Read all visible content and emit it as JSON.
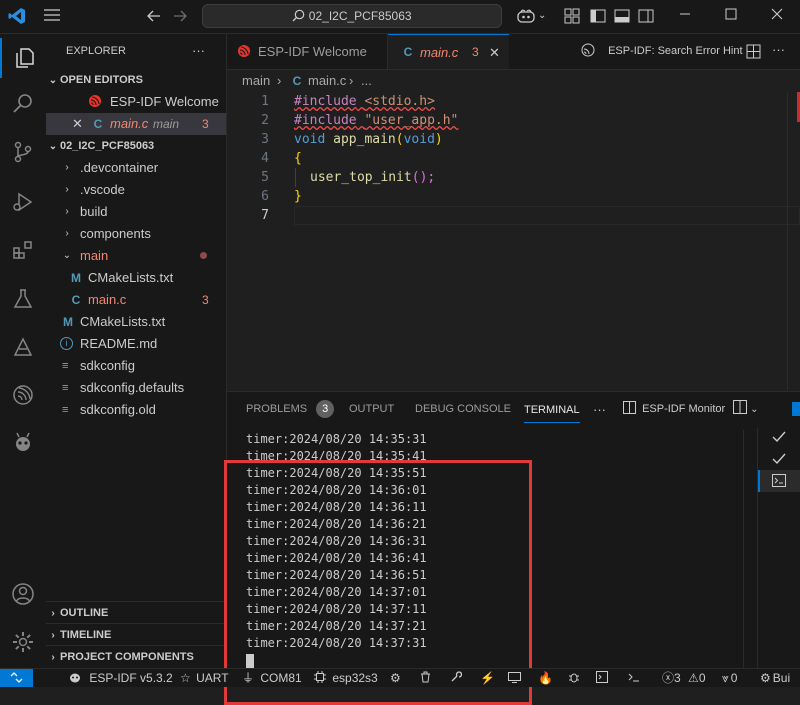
{
  "titlebar": {
    "search_text": "02_I2C_PCF85063"
  },
  "sidebar": {
    "title": "EXPLORER",
    "open_editors_label": "OPEN EDITORS",
    "open_editors": [
      {
        "name": "ESP-IDF Welcome"
      },
      {
        "name": "main.c",
        "folder": "main",
        "problems": "3"
      }
    ],
    "project_label": "02_I2C_PCF85063",
    "tree": [
      {
        "name": ".devcontainer"
      },
      {
        "name": ".vscode"
      },
      {
        "name": "build"
      },
      {
        "name": "components"
      },
      {
        "name": "main"
      },
      {
        "name": "CMakeLists.txt"
      },
      {
        "name": "main.c",
        "problems": "3"
      },
      {
        "name": "CMakeLists.txt"
      },
      {
        "name": "README.md"
      },
      {
        "name": "sdkconfig"
      },
      {
        "name": "sdkconfig.defaults"
      },
      {
        "name": "sdkconfig.old"
      }
    ],
    "outline_label": "OUTLINE",
    "timeline_label": "TIMELINE",
    "project_components_label": "PROJECT COMPONENTS"
  },
  "tabs": {
    "welcome": "ESP-IDF Welcome",
    "mainc": "main.c",
    "mainc_problems": "3",
    "hint": "ESP-IDF: Search Error Hint"
  },
  "breadcrumb": {
    "folder": "main",
    "file": "main.c",
    "rest": "..."
  },
  "editor": {
    "line_numbers": [
      "1",
      "2",
      "3",
      "4",
      "5",
      "6",
      "7"
    ],
    "lines": {
      "l1_kw": "#include",
      "l1_rest": "<stdio.h>",
      "l2_kw": "#include",
      "l2_rest": "\"user_app.h\"",
      "l3_void": "void",
      "l3_fn": "app_main",
      "l3_po": "(",
      "l3_arg": "void",
      "l3_pc": ")",
      "l4": "{",
      "l5_fn": "user_top_init",
      "l5_rest": "();",
      "l6": "}"
    }
  },
  "panel": {
    "tabs": {
      "problems": "PROBLEMS",
      "problems_count": "3",
      "output": "OUTPUT",
      "debug": "DEBUG CONSOLE",
      "terminal": "TERMINAL",
      "more": "···",
      "monitor": "ESP-IDF Monitor"
    },
    "terminal_lines": [
      "timer:2024/08/20 14:35:31",
      "timer:2024/08/20 14:35:41",
      "timer:2024/08/20 14:35:51",
      "timer:2024/08/20 14:36:01",
      "timer:2024/08/20 14:36:11",
      "timer:2024/08/20 14:36:21",
      "timer:2024/08/20 14:36:31",
      "timer:2024/08/20 14:36:41",
      "timer:2024/08/20 14:36:51",
      "timer:2024/08/20 14:37:01",
      "timer:2024/08/20 14:37:11",
      "timer:2024/08/20 14:37:21",
      "timer:2024/08/20 14:37:31"
    ]
  },
  "statusbar": {
    "idf": "ESP-IDF v5.3.2",
    "uart": "UART",
    "port": "COM81",
    "target": "esp32s3",
    "errors": "3",
    "warnings": "0",
    "zero": "0",
    "build": "Bui"
  },
  "colors": {
    "accent": "#0078d4",
    "error": "#f14c4c",
    "highlight_box": "#e03a3a",
    "keyword": "#569cd6",
    "preproc": "#c586c0",
    "string": "#ce9178",
    "function": "#dcdcaa"
  }
}
